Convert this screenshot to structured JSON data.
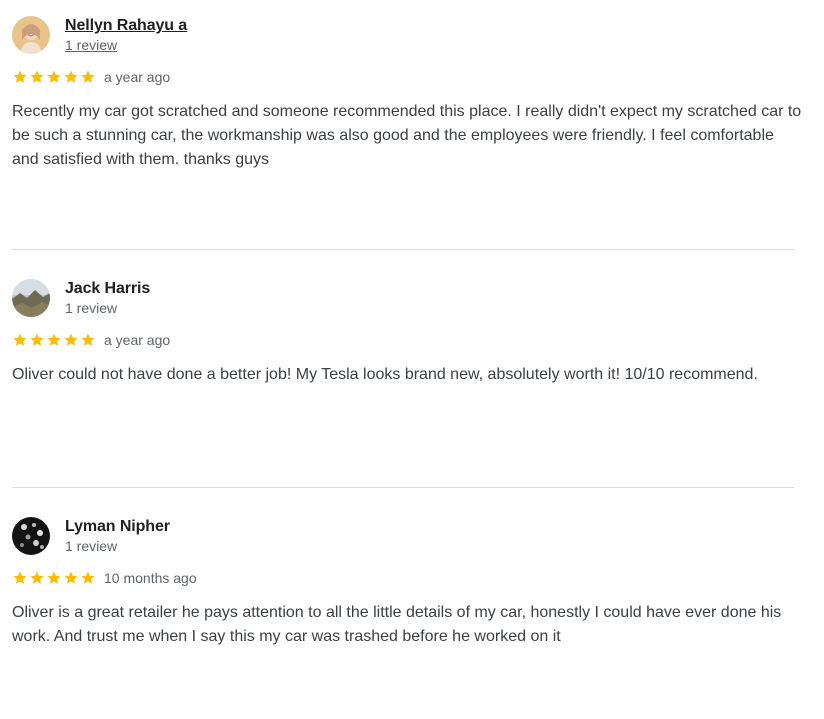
{
  "reviews": [
    {
      "name": "Nellyn Rahayu a",
      "count": "1 review",
      "rating": 5,
      "time": "a year ago",
      "text": "Recently my car got scratched and someone recommended this place. I really didn't expect my scratched car to be such a stunning car, the workmanship was also good and the employees were friendly. I feel comfortable and satisfied with them. thanks guys"
    },
    {
      "name": "Jack Harris",
      "count": "1 review",
      "rating": 5,
      "time": "a year ago",
      "text": "Oliver could not have done a better job! My Tesla looks brand new, absolutely worth it! 10/10 recommend."
    },
    {
      "name": "Lyman Nipher",
      "count": "1 review",
      "rating": 5,
      "time": "10 months ago",
      "text": "Oliver is a great retailer he pays attention to all the little details of my car, honestly I could have ever done his work. And trust me when I say this my car was trashed before he worked on it"
    }
  ],
  "colors": {
    "star": "#fbbc04",
    "name": "#202124",
    "meta": "#5f6368",
    "body": "#3c4043",
    "divider": "#dadce0"
  },
  "icons": {
    "star": "star-icon",
    "avatar": "avatar-photo"
  }
}
